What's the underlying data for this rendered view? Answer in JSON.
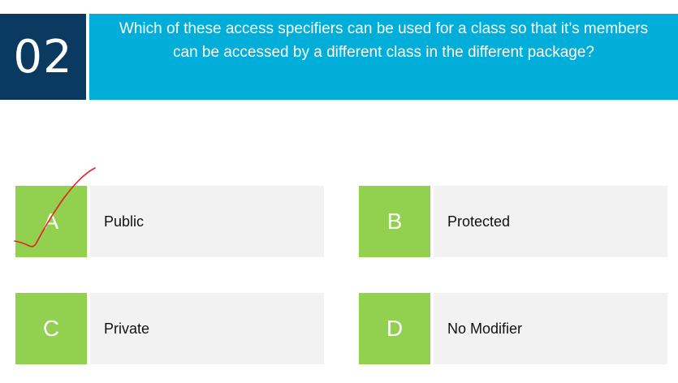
{
  "question": {
    "number": "02",
    "text": "Which of these access specifiers can be used for a class so that it’s members can be accessed by a different class in the different package?"
  },
  "options": [
    {
      "letter": "A",
      "text": "Public"
    },
    {
      "letter": "B",
      "text": "Protected"
    },
    {
      "letter": "C",
      "text": "Private"
    },
    {
      "letter": "D",
      "text": "No Modifier"
    }
  ],
  "colors": {
    "number_bg": "#0b3a61",
    "question_bg": "#00aed9",
    "letter_bg": "#92d050",
    "option_bg": "#f2f2f2",
    "check_mark": "#e8201c"
  },
  "annotation": {
    "check_icon": "hand-drawn-check-icon",
    "marked_option": "A"
  }
}
